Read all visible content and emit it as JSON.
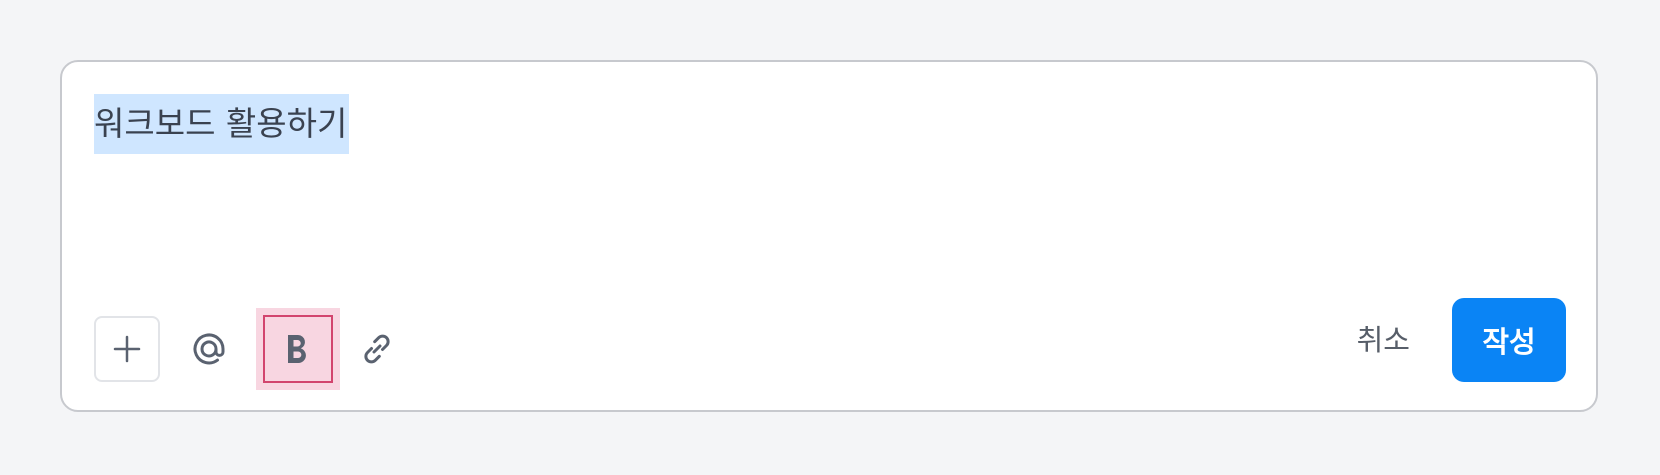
{
  "editor": {
    "text": "워크보드 활용하기"
  },
  "toolbar": {
    "icons": {
      "add": "plus-icon",
      "mention": "at-icon",
      "bold": "bold-icon",
      "link": "link-icon"
    }
  },
  "actions": {
    "cancel_label": "취소",
    "submit_label": "작성"
  },
  "colors": {
    "background": "#f4f5f7",
    "selection": "#cfe6ff",
    "accent": "#0a84f5",
    "highlight": "#d2456e",
    "highlight_fill": "#f8d6e1",
    "icon": "#5a6270"
  }
}
